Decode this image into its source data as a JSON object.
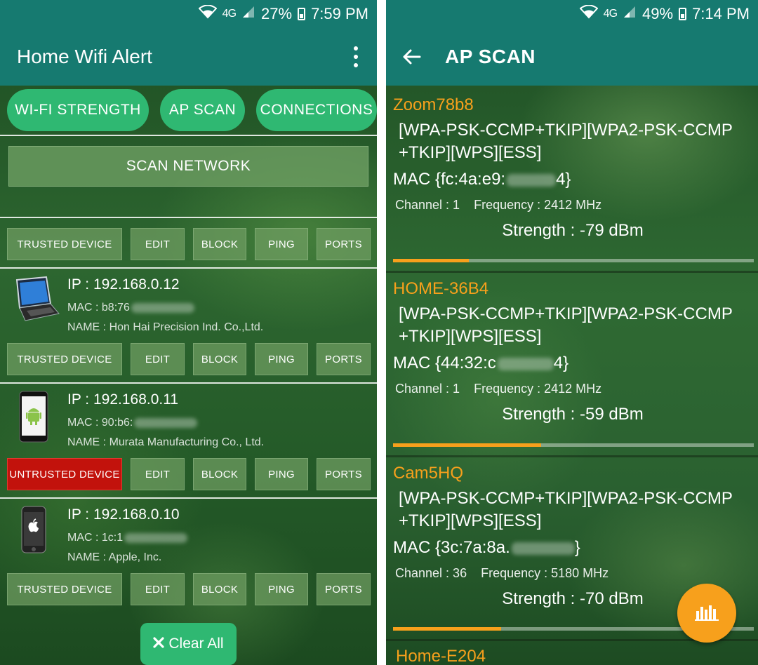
{
  "left": {
    "status": {
      "battery": "27%",
      "time": "7:59 PM",
      "network": "4G"
    },
    "app_title": "Home Wifi Alert",
    "tabs": [
      "WI-FI STRENGTH",
      "AP SCAN",
      "CONNECTIONS"
    ],
    "scan_button": "SCAN NETWORK",
    "action_labels": {
      "trusted": "TRUSTED DEVICE",
      "untrusted": "UNTRUSTED DEVICE",
      "edit": "EDIT",
      "block": "BLOCK",
      "ping": "PING",
      "ports": "PORTS"
    },
    "devices": [
      {
        "ip": "IP : 192.168.0.12",
        "mac": "MAC : b8:76",
        "name": "NAME : Hon Hai Precision Ind. Co.,Ltd.",
        "icon": "laptop-icon",
        "trust": "TRUSTED DEVICE"
      },
      {
        "ip": "IP : 192.168.0.11",
        "mac": "MAC : 90:b6:",
        "name": "NAME : Murata Manufacturing Co., Ltd.",
        "icon": "android-phone-icon",
        "trust": "UNTRUSTED DEVICE"
      },
      {
        "ip": "IP : 192.168.0.10",
        "mac": "MAC : 1c:1",
        "name": "NAME : Apple, Inc.",
        "icon": "iphone-icon",
        "trust": "TRUSTED DEVICE"
      }
    ],
    "clear_all": "Clear All"
  },
  "right": {
    "status": {
      "battery": "49%",
      "time": "7:14 PM",
      "network": "4G"
    },
    "title": "AP SCAN",
    "access_points": [
      {
        "ssid": "Zoom78b8",
        "caps_line1": "[WPA-PSK-CCMP+TKIP][WPA2-PSK-CCMP",
        "caps_line2": "+TKIP][WPS][ESS]",
        "mac_prefix": "MAC {fc:4a:e9:",
        "mac_suffix": "4}",
        "channel": "Channel : 1",
        "frequency": "Frequency : 2412 MHz",
        "strength": "Strength : -79 dBm",
        "signal_fraction": 0.21
      },
      {
        "ssid": "HOME-36B4",
        "caps_line1": "[WPA-PSK-CCMP+TKIP][WPA2-PSK-CCMP",
        "caps_line2": "+TKIP][WPS][ESS]",
        "mac_prefix": "MAC {44:32:c",
        "mac_suffix": "4}",
        "channel": "Channel : 1",
        "frequency": "Frequency : 2412 MHz",
        "strength": "Strength : -59 dBm",
        "signal_fraction": 0.41
      },
      {
        "ssid": "Cam5HQ",
        "caps_line1": "[WPA-PSK-CCMP+TKIP][WPA2-PSK-CCMP",
        "caps_line2": "+TKIP][WPS][ESS]",
        "mac_prefix": "MAC {3c:7a:8a.",
        "mac_suffix": "}",
        "channel": "Channel : 36",
        "frequency": "Frequency : 5180 MHz",
        "strength": "Strength : -70 dBm",
        "signal_fraction": 0.3
      }
    ],
    "partial_ssid": "Home-E204"
  },
  "colors": {
    "primary": "#167a70",
    "accent_green": "#2fb872",
    "orange": "#f7a01c",
    "untrusted_red": "#c2120c"
  }
}
